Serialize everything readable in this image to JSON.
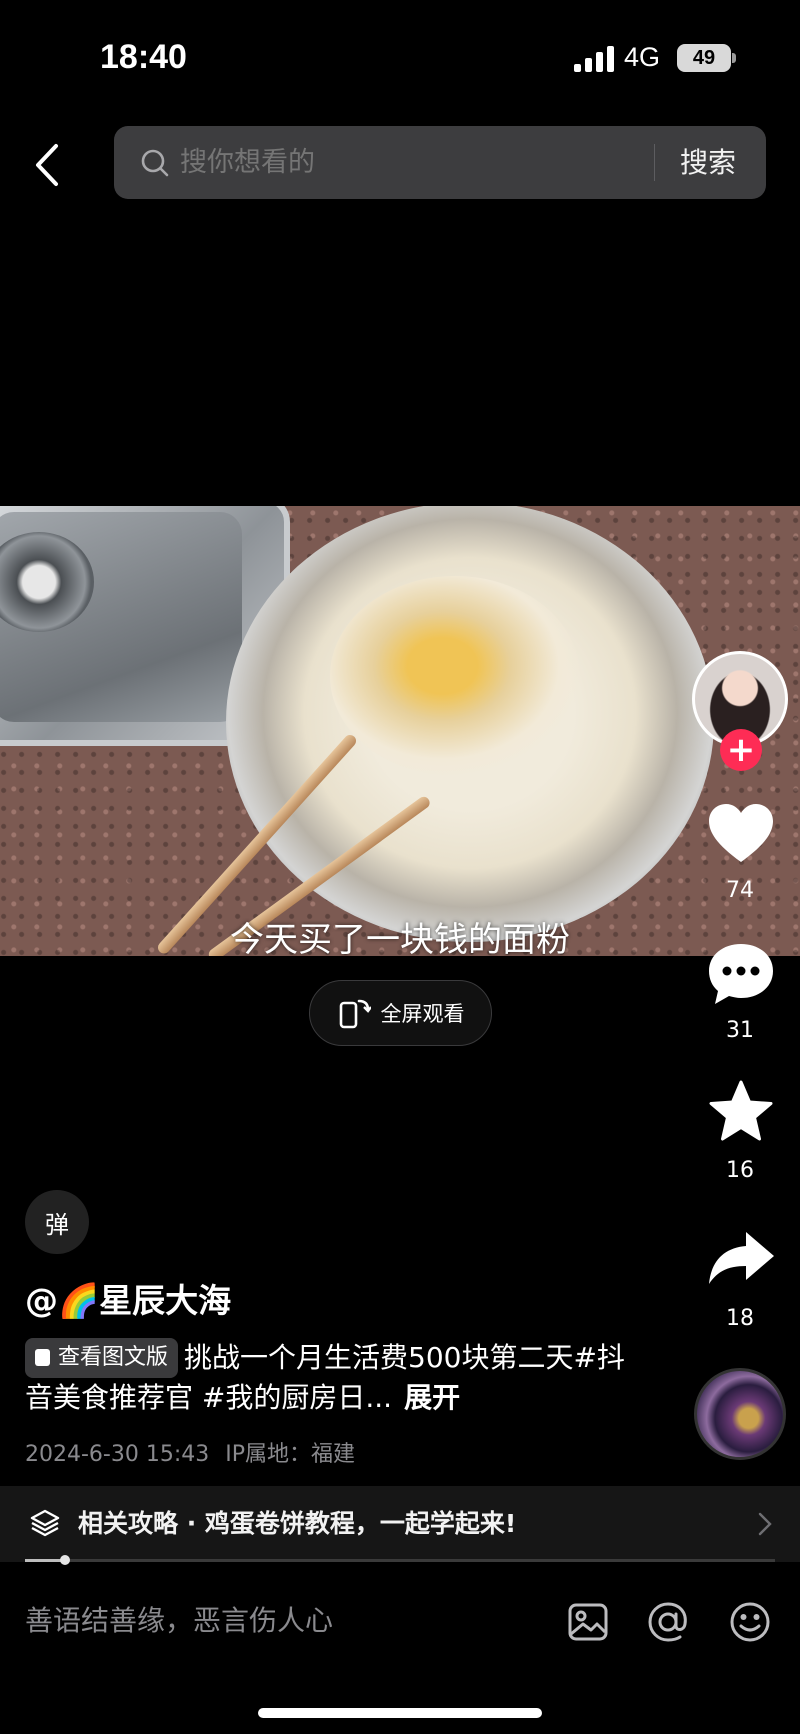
{
  "status_bar": {
    "time": "18:40",
    "network": "4G",
    "battery": "49"
  },
  "search": {
    "placeholder": "搜你想看的",
    "submit_label": "搜索"
  },
  "video": {
    "subtitle": "今天买了一块钱的面粉"
  },
  "fullscreen_label": "全屏观看",
  "actions": {
    "likes": "74",
    "comments": "31",
    "favorites": "16",
    "shares": "18"
  },
  "danmaku_label": "弹",
  "author": {
    "name": "@🌈星辰大海"
  },
  "caption": {
    "tag_label": "查看图文版",
    "text": "挑战一个月生活费500块第二天#抖音美食推荐官 #我的厨房日...",
    "expand": "展开"
  },
  "meta": {
    "date": "2024-6-30 15:43",
    "ip": "IP属地：福建"
  },
  "related": {
    "text": "相关攻略 · 鸡蛋卷饼教程，一起学起来!"
  },
  "progress": {
    "fraction": 0.053
  },
  "comment": {
    "placeholder": "善语结善缘，恶言伤人心"
  },
  "colors": {
    "accent": "#fe2c55",
    "background": "#000000",
    "search_bg": "#3d3d3f"
  }
}
